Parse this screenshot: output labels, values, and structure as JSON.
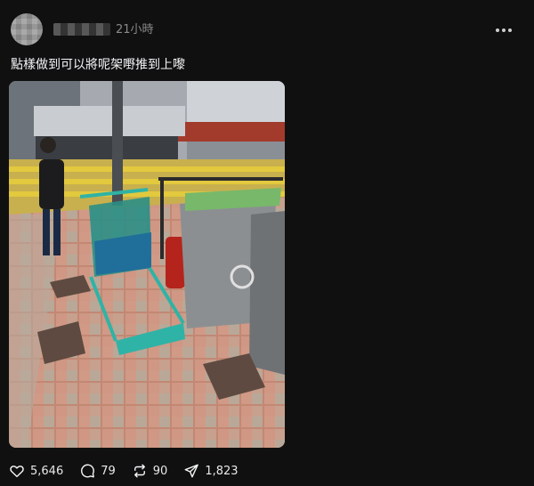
{
  "post": {
    "timestamp": "21小時",
    "text": "點樣做到可以將呢架嘢推到上嚟",
    "author_hidden": true
  },
  "actions": {
    "likes": "5,646",
    "comments": "79",
    "reposts": "90",
    "shares": "1,823"
  },
  "icons": {
    "like": "heart-icon",
    "comment": "comment-bubble-icon",
    "repost": "repost-arrows-icon",
    "share": "send-icon",
    "more": "more-dots-icon"
  },
  "colors": {
    "background": "#101010",
    "text": "#f3f5f7",
    "muted": "#8a8a8a"
  }
}
